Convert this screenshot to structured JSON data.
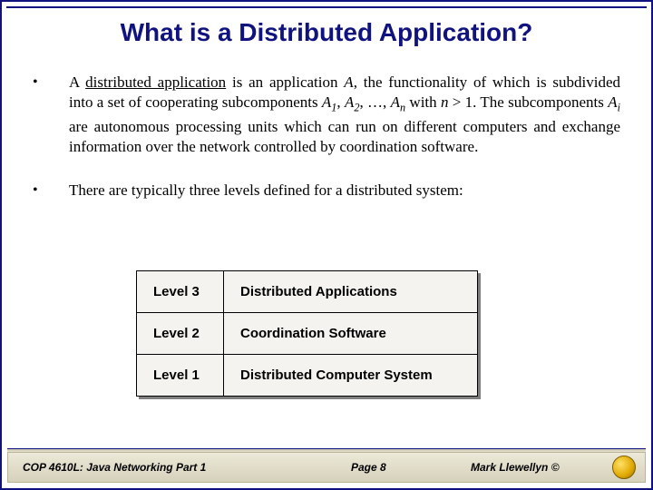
{
  "title": "What is a Distributed Application?",
  "bullets": {
    "b1_pre": "A ",
    "b1_ul": "distributed application",
    "b1_mid1": " is an application ",
    "b1_A": "A",
    "b1_mid2": ", the functionality of which is subdivided into a set of cooperating subcomponents ",
    "b1_A1": "A",
    "b1_s1": "1",
    "b1_c1": ", ",
    "b1_A2": "A",
    "b1_s2": "2",
    "b1_c2": ", …, ",
    "b1_An": "A",
    "b1_sn": "n",
    "b1_mid3": " with ",
    "b1_n": "n",
    "b1_gt": " > 1.  The subcomponents ",
    "b1_Ai": "A",
    "b1_si": "i",
    "b1_tail": " are autonomous processing units which can run on different computers and exchange information over the network controlled by coordination software.",
    "b2": "There are typically three levels defined for a distributed system:"
  },
  "table": {
    "rows": [
      {
        "level": "Level 3",
        "desc": "Distributed Applications"
      },
      {
        "level": "Level 2",
        "desc": "Coordination Software"
      },
      {
        "level": "Level 1",
        "desc": "Distributed Computer System"
      }
    ]
  },
  "footer": {
    "course": "COP 4610L: Java Networking Part 1",
    "page": "Page 8",
    "author": "Mark Llewellyn ©"
  }
}
